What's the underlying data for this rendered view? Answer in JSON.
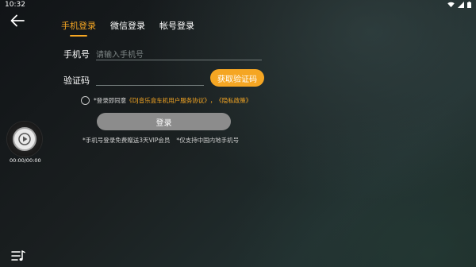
{
  "statusbar": {
    "time": "10:32",
    "icons": [
      "wifi-icon",
      "signal-icon",
      "battery-icon"
    ]
  },
  "header": {
    "back_icon": "back-arrow-icon",
    "tabs": [
      {
        "label": "手机登录",
        "active": true
      },
      {
        "label": "微信登录",
        "active": false
      },
      {
        "label": "帐号登录",
        "active": false
      }
    ]
  },
  "form": {
    "phone_label": "手机号",
    "phone_placeholder": "请输入手机号",
    "phone_value": "",
    "code_label": "验证码",
    "code_placeholder": "",
    "code_value": "",
    "get_code_button": "获取验证码"
  },
  "agreement": {
    "prefix": "*登录即同意",
    "service_link": "《DJ音乐盒车机用户服务协议》",
    "separator": "，",
    "privacy_link": "《隐私政策》",
    "checked": false
  },
  "login_button": "登录",
  "notes": [
    "*手机号登录免费赠送3天VIP会员",
    "*仅支持中国内地手机号"
  ],
  "player": {
    "time": "00:00/00:00",
    "disc_icon": "music-disc-icon",
    "play_icon": "play-icon"
  },
  "playlist_icon": "playlist-icon",
  "colors": {
    "accent": "#f5a623",
    "disabled_button": "#8c8c8c"
  }
}
